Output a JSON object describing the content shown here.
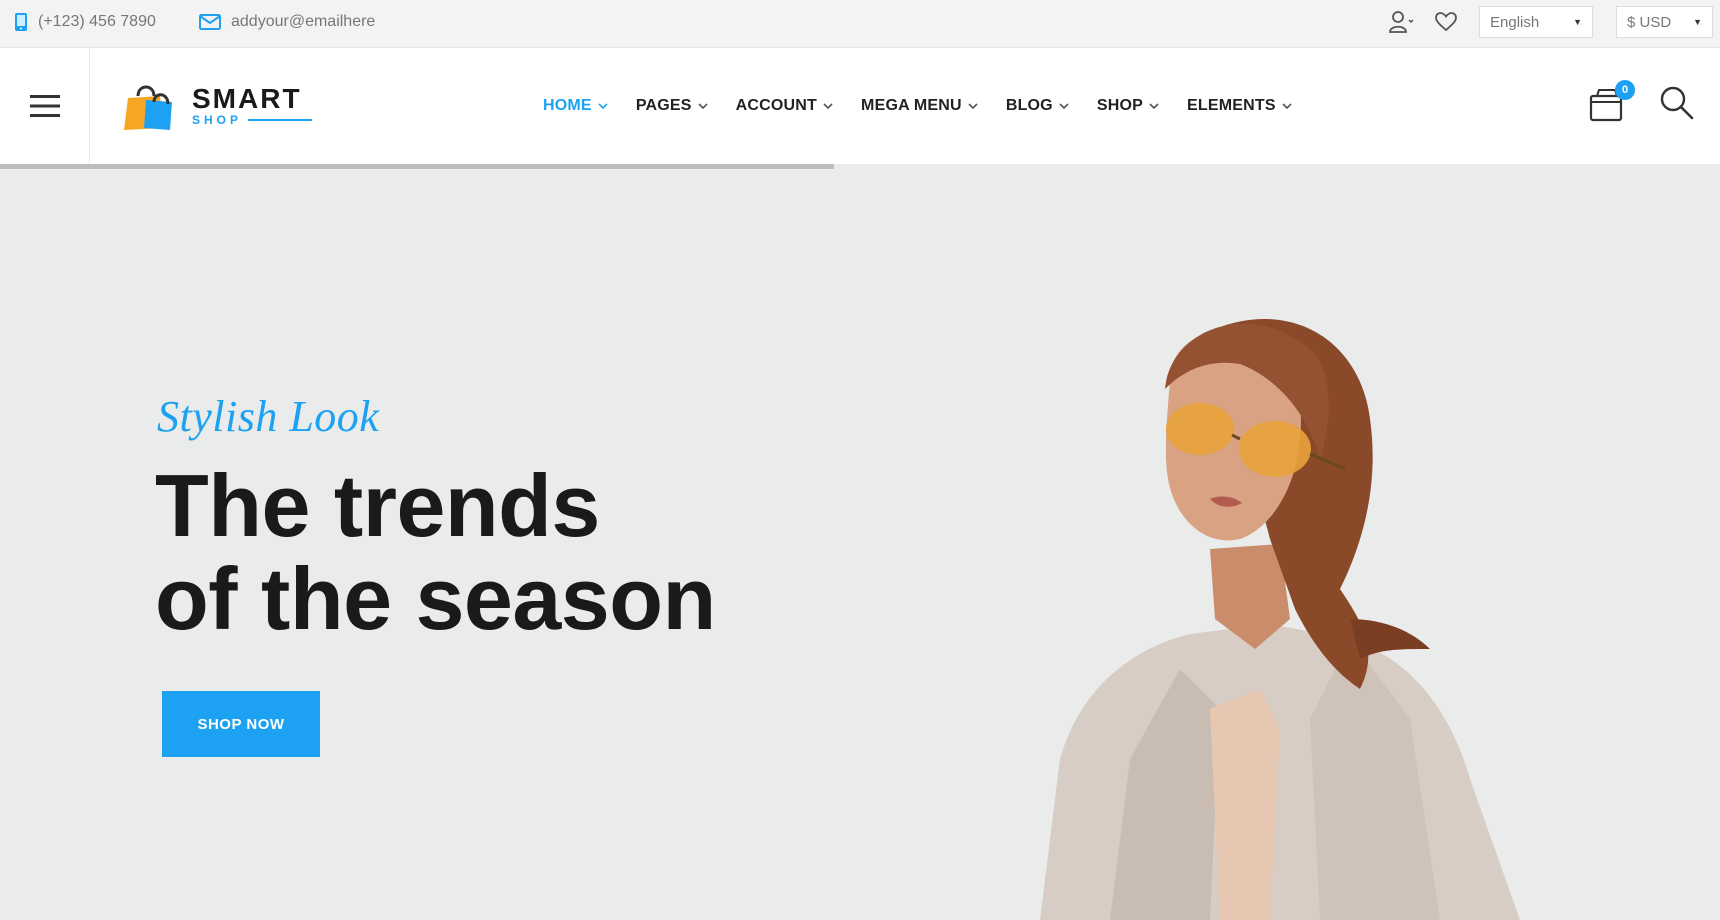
{
  "topbar": {
    "phone": "(+123) 456 7890",
    "email": "addyour@emailhere",
    "language": "English",
    "currency": "$ USD",
    "icons": [
      "phone-icon",
      "mail-icon",
      "user-icon",
      "heart-icon"
    ]
  },
  "logo": {
    "main": "SMART",
    "sub": "SHOP"
  },
  "nav": {
    "items": [
      {
        "label": "HOME",
        "active": true
      },
      {
        "label": "PAGES"
      },
      {
        "label": "ACCOUNT"
      },
      {
        "label": "MEGA MENU"
      },
      {
        "label": "BLOG"
      },
      {
        "label": "SHOP"
      },
      {
        "label": "ELEMENTS"
      }
    ]
  },
  "cart": {
    "count": "0"
  },
  "hero": {
    "subtitle": "Stylish Look",
    "title_line1": "The trends",
    "title_line2": "of the season",
    "button": "SHOP NOW",
    "slider_progress": 0.485
  },
  "colors": {
    "accent": "#1da1f2",
    "hero_bg": "#e9eceb",
    "text": "#1a1a1a"
  }
}
